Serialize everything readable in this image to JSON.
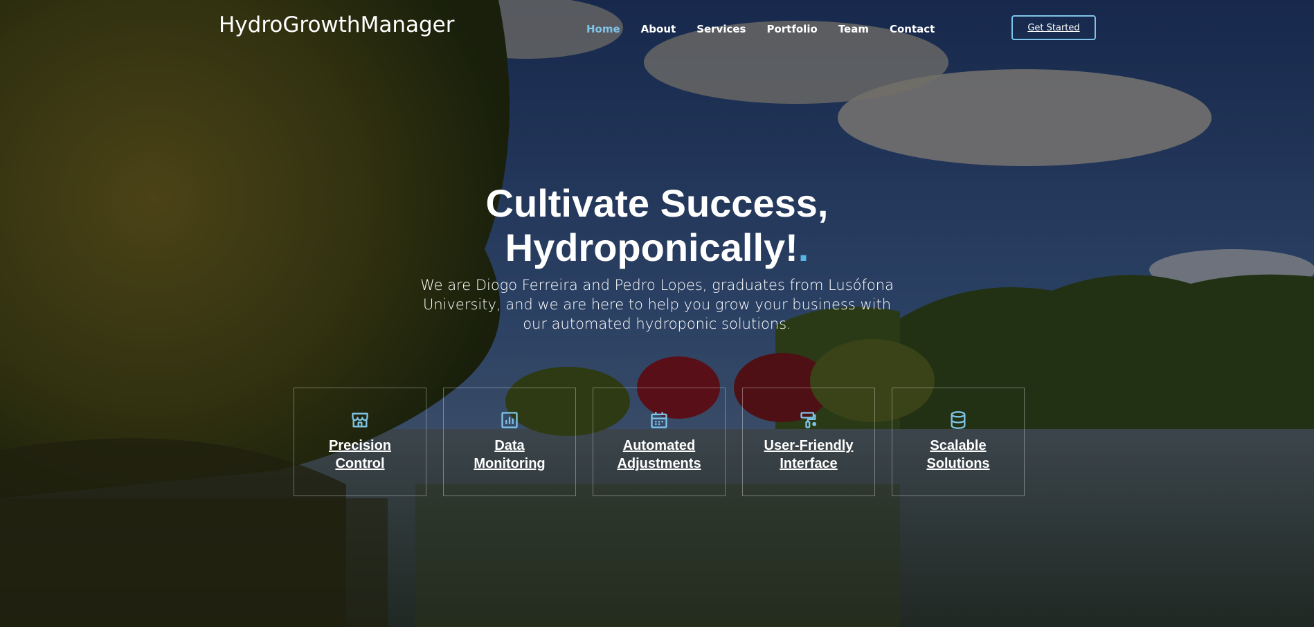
{
  "brand": {
    "name": "HydroGrowthManager",
    "accent_color": "#58b6e7"
  },
  "nav": {
    "items": [
      {
        "label": "Home",
        "active": true
      },
      {
        "label": "About"
      },
      {
        "label": "Services"
      },
      {
        "label": "Portfolio"
      },
      {
        "label": "Team"
      },
      {
        "label": "Contact"
      }
    ],
    "cta_label": "Get Started"
  },
  "hero": {
    "title_line1": "Cultivate Success,",
    "title_line2": "Hydroponically!",
    "title_dot": ".",
    "subtitle": "We are Diogo Ferreira and Pedro Lopes, graduates from Lusófona University, and we are here to help you grow your business with our automated hydroponic solutions."
  },
  "features": [
    {
      "icon": "store-icon",
      "line1": "Precision",
      "line2": "Control"
    },
    {
      "icon": "bar-chart-icon",
      "line1": "Data",
      "line2": "Monitoring"
    },
    {
      "icon": "calendar-icon",
      "line1": "Automated",
      "line2": "Adjustments"
    },
    {
      "icon": "paint-roller-icon",
      "line1": "User-Friendly",
      "line2": "Interface"
    },
    {
      "icon": "database-icon",
      "line1": "Scalable",
      "line2": "Solutions"
    }
  ]
}
